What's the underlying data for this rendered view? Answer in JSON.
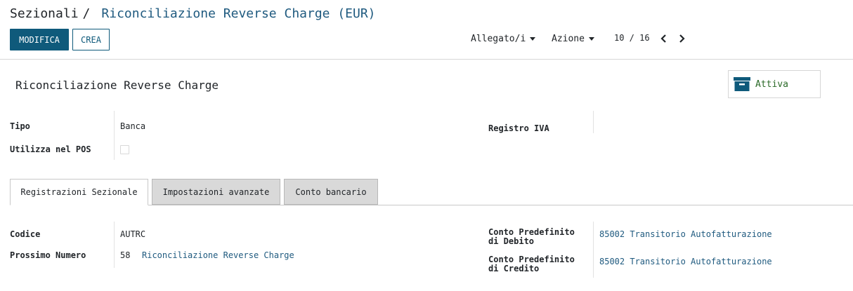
{
  "breadcrumb": {
    "parent": "Sezionali",
    "separator": "/",
    "current": "Riconciliazione Reverse Charge (EUR)"
  },
  "buttons": {
    "edit": "MODIFICA",
    "create": "CREA"
  },
  "dropdowns": {
    "attachments": "Allegato/i",
    "action": "Azione"
  },
  "pager": {
    "value": "10 / 16",
    "prev_icon": "chevron-left-icon",
    "next_icon": "chevron-right-icon"
  },
  "record": {
    "title": "Riconciliazione Reverse Charge"
  },
  "smart_button": {
    "icon": "archive-icon",
    "label": "Attiva",
    "label_color": "#2b6a28"
  },
  "fields": {
    "type_label": "Tipo",
    "type_value": "Banca",
    "pos_label": "Utilizza nel POS",
    "pos_checked": false,
    "vat_register_label": "Registro IVA",
    "vat_register_value": ""
  },
  "tabs": [
    {
      "label": "Registrazioni Sezionale",
      "active": true
    },
    {
      "label": "Impostazioni avanzate",
      "active": false
    },
    {
      "label": "Conto bancario",
      "active": false
    }
  ],
  "tab_content": {
    "code_label": "Codice",
    "code_value": "AUTRC",
    "next_number_label": "Prossimo Numero",
    "next_number_value": "58",
    "next_number_sequence": "Riconciliazione Reverse Charge",
    "debit_label_line1": "Conto Predefinito",
    "debit_label_line2": "di Debito",
    "debit_value": "85002 Transitorio Autofatturazione",
    "credit_label_line1": "Conto Predefinito",
    "credit_label_line2": "di Credito",
    "credit_value": "85002 Transitorio Autofatturazione"
  },
  "colors": {
    "primary": "#0f5a7b",
    "link": "#1f5a7f"
  }
}
